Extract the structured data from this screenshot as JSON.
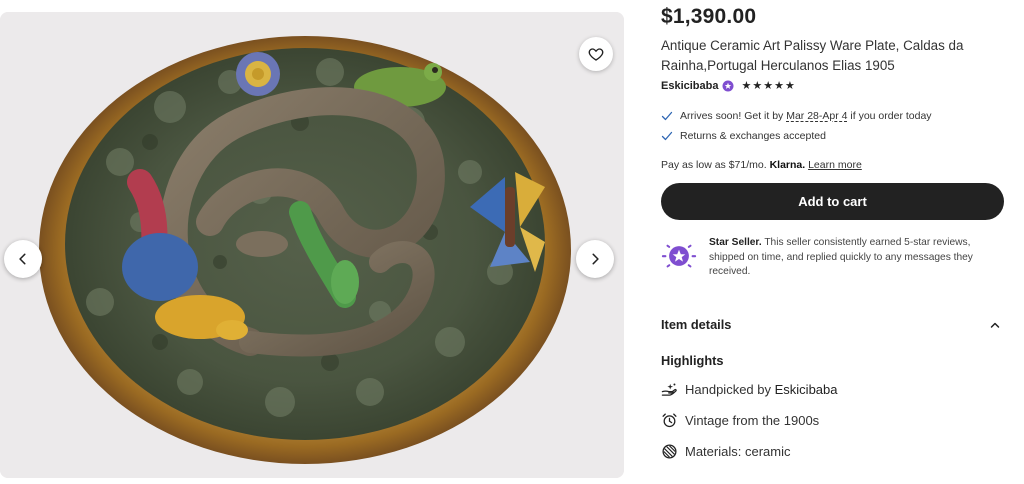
{
  "listing": {
    "price": "$1,390.00",
    "title": "Antique Ceramic Art Palissy Ware Plate, Caldas da Rainha,Portugal Herculanos Elias 1905",
    "seller_name": "Eskicibaba",
    "rating_stars": 5
  },
  "shipping": {
    "arrives_prefix": "Arrives soon! Get it by",
    "arrives_dates": "Mar 28-Apr 4",
    "arrives_suffix": "if you order today",
    "returns": "Returns & exchanges accepted"
  },
  "payment": {
    "pay_prefix": "Pay as low as $71/mo.",
    "klarna": "Klarna.",
    "learn_more": "Learn more"
  },
  "cart": {
    "add_label": "Add to cart"
  },
  "star_seller": {
    "heading": "Star Seller.",
    "text": "This seller consistently earned 5-star reviews, shipped on time, and replied quickly to any messages they received."
  },
  "details": {
    "item_details": "Item details",
    "highlights_heading": "Highlights",
    "handpicked_prefix": "Handpicked by",
    "handpicked_seller": "Eskicibaba",
    "vintage": "Vintage from the 1900s",
    "materials": "Materials: ceramic"
  },
  "icons": {
    "favorite": "heart-icon",
    "prev": "chevron-left-icon",
    "next": "chevron-right-icon",
    "check": "check-icon",
    "collapse": "chevron-up-icon",
    "handpicked": "hand-icon",
    "vintage": "alarm-clock-icon",
    "materials": "material-icon",
    "star_seller_badge": "star-badge-icon"
  },
  "colors": {
    "accent_purple": "#7f4ed0",
    "button_dark": "#222222",
    "check_blue": "#2f66b3"
  }
}
